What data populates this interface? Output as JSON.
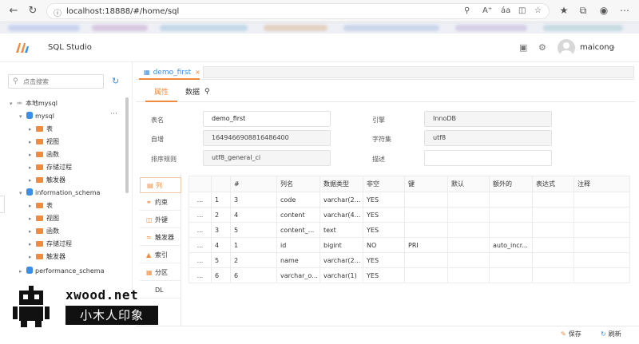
{
  "browser": {
    "url": "localhost:18888/#/home/sql"
  },
  "app": {
    "title": "SQL Studio",
    "username": "maicong"
  },
  "sidebar": {
    "search_placeholder": "点击搜索",
    "tree": {
      "connection": "本地mysql",
      "databases": [
        {
          "name": "mysql",
          "children": [
            "表",
            "视图",
            "函数",
            "存储过程",
            "触发器"
          ]
        },
        {
          "name": "information_schema",
          "children": [
            "表",
            "视图",
            "函数",
            "存储过程",
            "触发器"
          ]
        },
        {
          "name": "performance_schema"
        }
      ]
    }
  },
  "tabs": {
    "open_tab": "demo_first"
  },
  "subtabs": {
    "properties": "属性",
    "data": "数据"
  },
  "properties": {
    "table_name_label": "表名",
    "table_name": "demo_first",
    "auto_inc_label": "自增",
    "auto_inc": "1649466908816486400",
    "collation_label": "排序规则",
    "collation": "utf8_general_ci",
    "engine_label": "引擎",
    "engine": "InnoDB",
    "charset_label": "字符集",
    "charset": "utf8",
    "description_label": "描述",
    "description": ""
  },
  "side_tabs": [
    "列",
    "约束",
    "外键",
    "触发器",
    "索引",
    "分区",
    "DL"
  ],
  "columns_table": {
    "headers": [
      "",
      "",
      "#",
      "列名",
      "数据类型",
      "非空",
      "键",
      "默认",
      "额外的",
      "表达式",
      "注释"
    ],
    "rows": [
      [
        "...",
        "1",
        "3",
        "code",
        "varchar(2...",
        "YES",
        "",
        "",
        "",
        "",
        ""
      ],
      [
        "...",
        "2",
        "4",
        "content",
        "varchar(4...",
        "YES",
        "",
        "",
        "",
        "",
        ""
      ],
      [
        "...",
        "3",
        "5",
        "content_...",
        "text",
        "YES",
        "",
        "",
        "",
        "",
        ""
      ],
      [
        "...",
        "4",
        "1",
        "id",
        "bigint",
        "NO",
        "PRI",
        "",
        "auto_incr...",
        "",
        ""
      ],
      [
        "...",
        "5",
        "2",
        "name",
        "varchar(2...",
        "YES",
        "",
        "",
        "",
        "",
        ""
      ],
      [
        "...",
        "6",
        "6",
        "varchar_o...",
        "varchar(1)",
        "YES",
        "",
        "",
        "",
        "",
        ""
      ]
    ]
  },
  "watermark": {
    "brand": "xwood.net",
    "subtitle": "小木人印象"
  },
  "footer": {
    "save": "保存",
    "refresh": "刷新"
  },
  "colors": {
    "accent_orange": "#f08a3c",
    "accent_blue": "#3a8ee6"
  }
}
